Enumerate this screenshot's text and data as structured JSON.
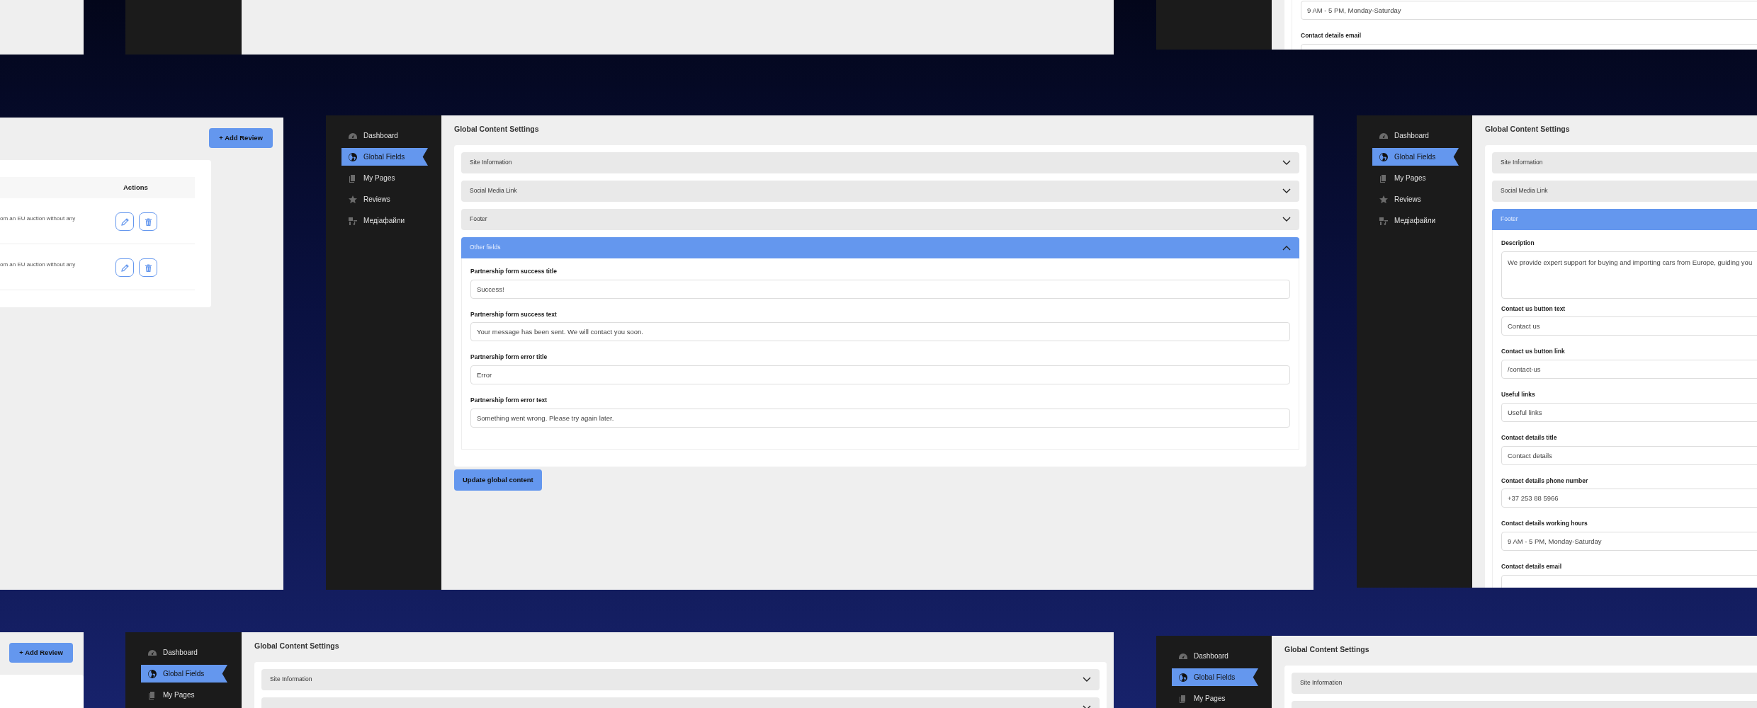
{
  "windows": [
    {
      "kind": "settings",
      "page": {
        "sections": [
          {
            "fields": [
              {
                "kind": "input",
                "value": "9 AM - 5 PM, Monday-Saturday"
              },
              {
                "kind": "input",
                "label": "Contact details email"
              }
            ]
          }
        ]
      }
    },
    {
      "kind": "reviews",
      "add_button": "+ Add Review",
      "table": {
        "columns": [
          "Actions"
        ],
        "rows": [
          {
            "text": "om an EU auction without any"
          },
          {
            "text": "om an EU auction without any"
          }
        ]
      }
    },
    {
      "kind": "settings",
      "sidebar": {
        "items": [
          {
            "label": "Dashboard",
            "selected": false
          },
          {
            "label": "Global Fields",
            "selected": true
          },
          {
            "label": "My Pages",
            "selected": false
          },
          {
            "label": "Reviews",
            "selected": false
          },
          {
            "label": "Медіафайли",
            "selected": false
          }
        ]
      },
      "page": {
        "title": "Global Content Settings",
        "sections": [
          {
            "title": "Site Information",
            "expanded": false
          },
          {
            "title": "Social Media Link",
            "expanded": false
          },
          {
            "title": "Footer",
            "expanded": false
          },
          {
            "title": "Other fields",
            "expanded": true,
            "fields": [
              {
                "kind": "input",
                "label": "Partnership form success title",
                "value": "Success!"
              },
              {
                "kind": "input",
                "label": "Partnership form success text",
                "value": "Your message has been sent. We will contact you soon."
              },
              {
                "kind": "input",
                "label": "Partnership form error title",
                "value": "Error"
              },
              {
                "kind": "input",
                "label": "Partnership form error text",
                "value": "Something went wrong. Please try again later."
              }
            ]
          }
        ],
        "button": "Update global content"
      }
    },
    {
      "kind": "settings",
      "sidebar": {
        "items": [
          {
            "label": "Dashboard",
            "selected": false
          },
          {
            "label": "Global Fields",
            "selected": true
          },
          {
            "label": "My Pages",
            "selected": false
          },
          {
            "label": "Reviews",
            "selected": false
          },
          {
            "label": "Медіафайли",
            "selected": false
          }
        ]
      },
      "page": {
        "title": "Global Content Settings",
        "sections": [
          {
            "title": "Site Information",
            "expanded": false
          },
          {
            "title": "Social Media Link",
            "expanded": false
          },
          {
            "title": "Footer",
            "expanded": true,
            "fields": [
              {
                "kind": "textarea",
                "label": "Description",
                "value": "We provide expert support for buying and importing cars from Europe, guiding you"
              },
              {
                "kind": "input",
                "label": "Contact us button text",
                "value": "Contact us"
              },
              {
                "kind": "input",
                "label": "Contact us button link",
                "value": "/contact-us"
              },
              {
                "kind": "input",
                "label": "Useful links",
                "value": "Useful links"
              },
              {
                "kind": "input",
                "label": "Contact details title",
                "value": "Contact details"
              },
              {
                "kind": "input",
                "label": "Contact details phone number",
                "value": "+37 253 88 5966"
              },
              {
                "kind": "input",
                "label": "Contact details working hours",
                "value": "9 AM - 5 PM, Monday-Saturday"
              },
              {
                "kind": "input",
                "label": "Contact details email"
              }
            ]
          }
        ]
      }
    },
    {
      "kind": "reviews",
      "add_button": "+ Add Review"
    },
    {
      "kind": "settings",
      "sidebar": {
        "items": [
          {
            "label": "Dashboard",
            "selected": false
          },
          {
            "label": "Global Fields",
            "selected": true
          },
          {
            "label": "My Pages",
            "selected": false
          }
        ]
      },
      "page": {
        "title": "Global Content Settings",
        "sections": [
          {
            "title": "Site Information",
            "expanded": false
          },
          {
            "expanded": false
          }
        ]
      }
    },
    {
      "kind": "settings",
      "sidebar": {
        "items": [
          {
            "label": "Dashboard",
            "selected": false
          },
          {
            "label": "Global Fields",
            "selected": true
          },
          {
            "label": "My Pages",
            "selected": false
          }
        ]
      },
      "page": {
        "title": "Global Content Settings",
        "sections": [
          {
            "title": "Site Information",
            "expanded": false
          },
          {
            "expanded": false
          }
        ]
      }
    }
  ]
}
